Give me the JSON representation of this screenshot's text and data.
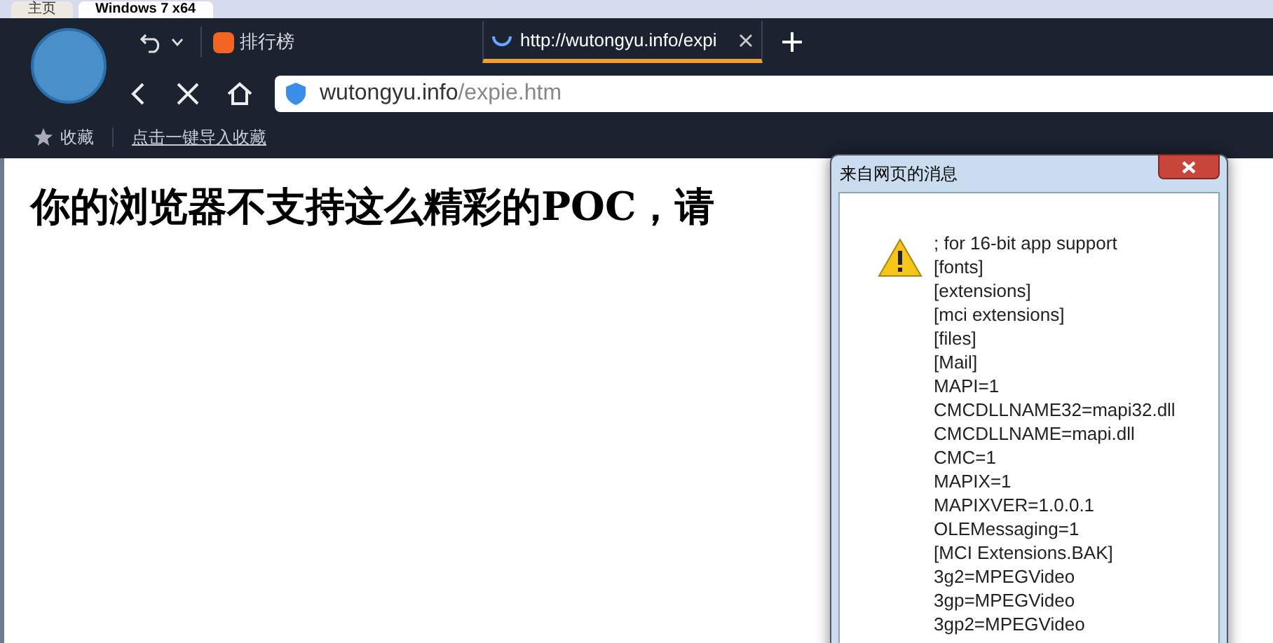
{
  "outer_tabs": [
    {
      "label": "主页",
      "selected": false
    },
    {
      "label": "Windows 7 x64",
      "selected": true
    }
  ],
  "toolbar": {
    "bookmark_item": "排行榜"
  },
  "tabs": [
    {
      "title": "http://wutongyu.info/expi",
      "loading": true,
      "selected": true
    }
  ],
  "address_bar": {
    "host": "wutongyu.info",
    "path": "/expie.htm"
  },
  "bookmarks_bar": {
    "label": "收藏",
    "import_link": "点击一键导入收藏"
  },
  "page": {
    "heading": "你的浏览器不支持这么精彩的POC，请"
  },
  "dialog": {
    "title": "来自网页的消息",
    "lines": [
      "; for 16-bit app support",
      "[fonts]",
      "[extensions]",
      "[mci extensions]",
      "[files]",
      "[Mail]",
      "MAPI=1",
      "CMCDLLNAME32=mapi32.dll",
      "CMCDLLNAME=mapi.dll",
      "CMC=1",
      "MAPIX=1",
      "MAPIXVER=1.0.0.1",
      "OLEMessaging=1",
      "[MCI Extensions.BAK]",
      "3g2=MPEGVideo",
      "3gp=MPEGVideo",
      "3gp2=MPEGVideo"
    ]
  }
}
